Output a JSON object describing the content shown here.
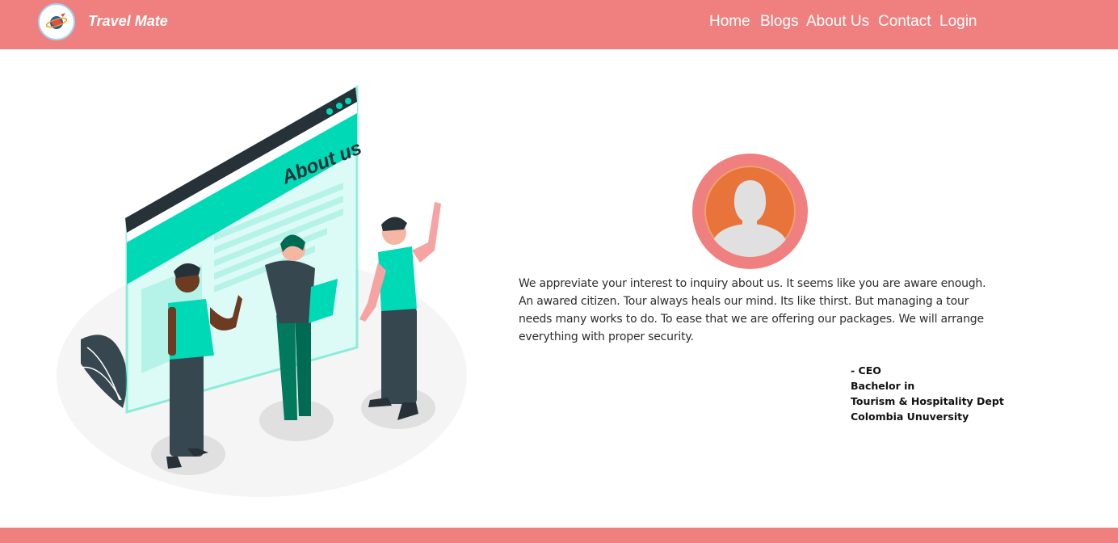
{
  "header": {
    "brand": "Travel Mate",
    "nav": [
      "Home",
      "Blogs",
      "About Us",
      "Contact",
      "Login"
    ],
    "logo_icon": "globe-plane-icon"
  },
  "illustration": {
    "heading": "About us",
    "icon": "team-about-us-illustration"
  },
  "about": {
    "text": "We appreviate your interest to inquiry about us. It seems like you are aware enough. An awared citizen. Tour always heals our mind. Its like thirst. But managing a tour needs many works to do. To ease that we are offering our packages. We will arrange everything with proper security.",
    "signature": [
      "- CEO",
      "Bachelor in",
      "Tourism & Hospitality Dept",
      "Colombia Unuversity"
    ]
  },
  "colors": {
    "primary": "#f08080",
    "accent": "#00d9b5",
    "avatar_bg": "#e8743b",
    "dark": "#263238"
  }
}
